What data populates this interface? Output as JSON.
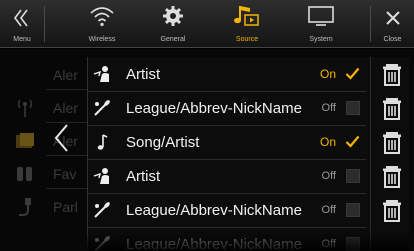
{
  "topbar": {
    "menu_label": "Menu",
    "wireless_label": "Wireless",
    "general_label": "General",
    "source_label": "Source",
    "system_label": "System",
    "close_label": "Close"
  },
  "background_list": [
    "Aler",
    "Aler",
    "Aler",
    "Fav",
    "Parl"
  ],
  "popup": {
    "rows": [
      {
        "label": "Artist",
        "state": "On",
        "checked": true,
        "icon": "artist-icon"
      },
      {
        "label": "League/Abbrev-NickName",
        "state": "Off",
        "checked": false,
        "icon": "sports-icon"
      },
      {
        "label": "Song/Artist",
        "state": "On",
        "checked": true,
        "icon": "music-note-icon"
      },
      {
        "label": "Artist",
        "state": "Off",
        "checked": false,
        "icon": "artist-icon"
      },
      {
        "label": "League/Abbrev-NickName",
        "state": "Off",
        "checked": false,
        "icon": "sports-icon"
      },
      {
        "label": "League/Abbrev-NickName",
        "state": "Off",
        "checked": false,
        "icon": "sports-icon"
      }
    ]
  },
  "colors": {
    "accent": "#f5b400",
    "checkbox_off": "#2c2c2c",
    "background": "#000000"
  }
}
